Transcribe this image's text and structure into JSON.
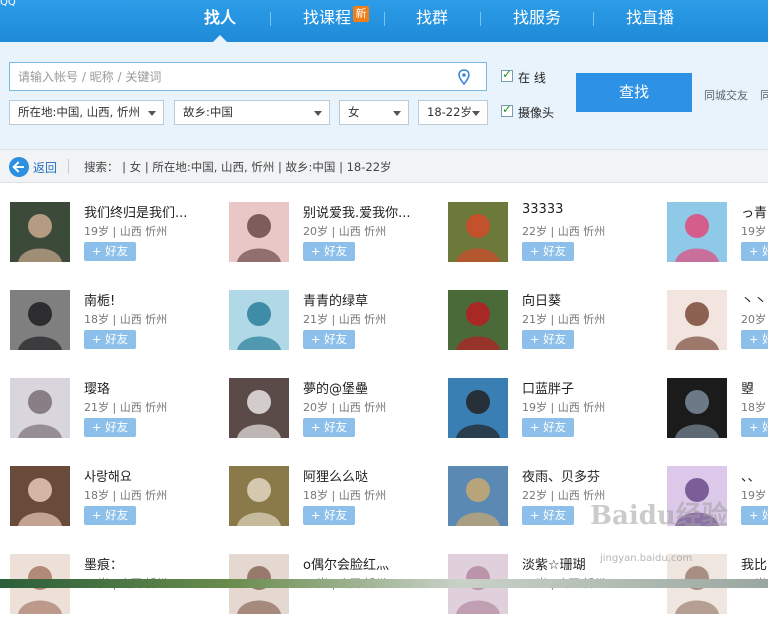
{
  "nav": {
    "logo_stub": "QQ",
    "tabs": [
      {
        "label": "找人"
      },
      {
        "label": "找课程",
        "badge": "新"
      },
      {
        "label": "找群"
      },
      {
        "label": "找服务"
      },
      {
        "label": "找直播"
      }
    ]
  },
  "search": {
    "placeholder": "请输入帐号 / 昵称 / 关键词",
    "value": "",
    "location": "所在地:中国, 山西, 忻州",
    "hometown": "故乡:中国",
    "gender": "女",
    "age": "18-22岁",
    "online_label": "在  线",
    "online_checked": true,
    "camera_label": "摄像头",
    "camera_checked": true,
    "find_button": "查找",
    "same_city_link": "同城交友",
    "more_link": "同"
  },
  "filter": {
    "back_label": "返回",
    "summary": "搜索：  |  女  |  所在地:中国, 山西, 忻州  |  故乡:中国  |  18-22岁"
  },
  "add_label": "+ 好友",
  "results": [
    {
      "name": "我们终归是我们...",
      "info": "19岁 | 山西 忻州"
    },
    {
      "name": "别说爱我.爱我你...",
      "info": "20岁 | 山西 忻州"
    },
    {
      "name": "33333",
      "info": "22岁 | 山西 忻州"
    },
    {
      "name": "っ青",
      "info": "19岁"
    },
    {
      "name": "南栀!",
      "info": "18岁 | 山西 忻州"
    },
    {
      "name": "青青的绿草",
      "info": "21岁 | 山西 忻州"
    },
    {
      "name": "向日葵",
      "info": "21岁 | 山西 忻州"
    },
    {
      "name": "丶丶",
      "info": "20岁"
    },
    {
      "name": "璎珞",
      "info": "21岁 | 山西 忻州"
    },
    {
      "name": "夢的@堡壘",
      "info": "20岁 | 山西 忻州"
    },
    {
      "name": "口蓝胖子",
      "info": "19岁 | 山西 忻州"
    },
    {
      "name": "曌",
      "info": "18岁"
    },
    {
      "name": "사랑해요",
      "info": "18岁 | 山西 忻州"
    },
    {
      "name": "阿狸么么哒",
      "info": "18岁 | 山西 忻州"
    },
    {
      "name": "夜雨、贝多芬",
      "info": "22岁 | 山西 忻州"
    },
    {
      "name": "、、",
      "info": "19岁"
    },
    {
      "name": "墨痕：",
      "info": "19岁 | 山西 忻州"
    },
    {
      "name": "o偶尔会脸红灬",
      "info": "18岁 | 山西 忻州"
    },
    {
      "name": "淡紫☆珊瑚",
      "info": "19岁 | 山西 忻州"
    },
    {
      "name": "我比",
      "info": "21岁"
    }
  ],
  "watermark": {
    "main": "Baidu经验",
    "sub": "jingyan.baidu.com"
  },
  "colors": {
    "nav_blue": "#2d9de8",
    "find_button": "#2d91e5",
    "add_button": "#8cc0ea",
    "new_badge": "#f07d16"
  }
}
